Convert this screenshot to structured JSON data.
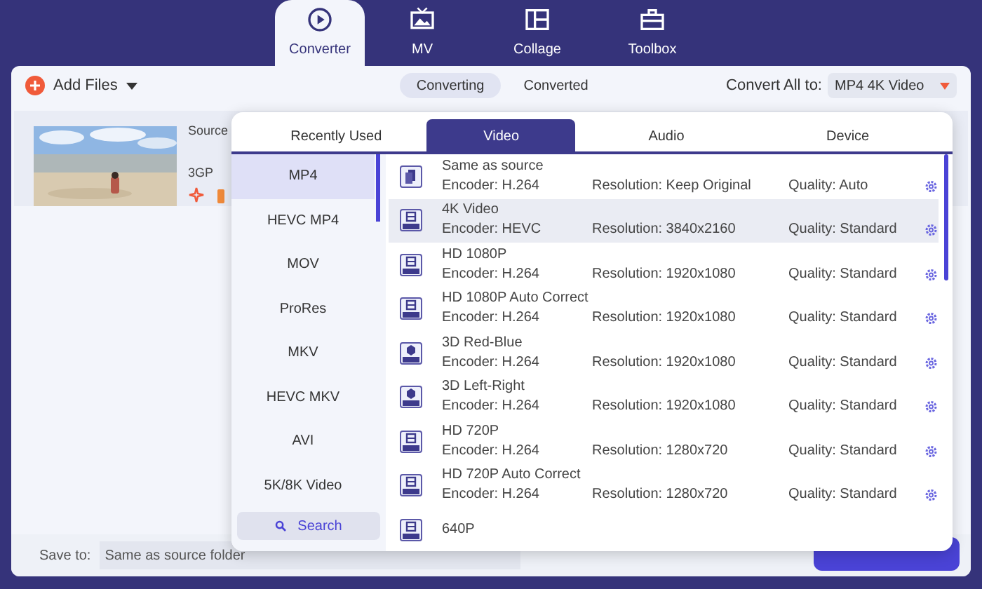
{
  "nav_tabs": [
    {
      "label": "Converter",
      "kind": "converter",
      "selected": true
    },
    {
      "label": "MV",
      "kind": "mv",
      "selected": false
    },
    {
      "label": "Collage",
      "kind": "collage",
      "selected": false
    },
    {
      "label": "Toolbox",
      "kind": "toolbox",
      "selected": false
    }
  ],
  "toolbar": {
    "add_files": "Add Files",
    "segments": [
      {
        "label": "Converting",
        "selected": true
      },
      {
        "label": "Converted",
        "selected": false
      }
    ],
    "convert_all_label": "Convert All to:",
    "convert_all_value": "MP4 4K Video"
  },
  "file": {
    "source_label": "Source",
    "format": "3GP"
  },
  "format_popup": {
    "tabs": [
      {
        "label": "Recently Used",
        "selected": false
      },
      {
        "label": "Video",
        "selected": true
      },
      {
        "label": "Audio",
        "selected": false
      },
      {
        "label": "Device",
        "selected": false
      }
    ],
    "categories": [
      {
        "label": "MP4",
        "selected": true
      },
      {
        "label": "HEVC MP4",
        "selected": false
      },
      {
        "label": "MOV",
        "selected": false
      },
      {
        "label": "ProRes",
        "selected": false
      },
      {
        "label": "MKV",
        "selected": false
      },
      {
        "label": "HEVC MKV",
        "selected": false
      },
      {
        "label": "AVI",
        "selected": false
      },
      {
        "label": "5K/8K Video",
        "selected": false
      }
    ],
    "search": "Search",
    "presets": [
      {
        "kind": "copy",
        "name": "Same as source",
        "encoder": "Encoder: H.264",
        "resolution": "Resolution: Keep Original",
        "quality": "Quality: Auto",
        "selected": false
      },
      {
        "kind": "film",
        "name": "4K Video",
        "encoder": "Encoder: HEVC",
        "resolution": "Resolution: 3840x2160",
        "quality": "Quality: Standard",
        "selected": true
      },
      {
        "kind": "film",
        "name": "HD 1080P",
        "encoder": "Encoder: H.264",
        "resolution": "Resolution: 1920x1080",
        "quality": "Quality: Standard",
        "selected": false
      },
      {
        "kind": "film",
        "name": "HD 1080P Auto Correct",
        "encoder": "Encoder: H.264",
        "resolution": "Resolution: 1920x1080",
        "quality": "Quality: Standard",
        "selected": false
      },
      {
        "kind": "cube",
        "name": "3D Red-Blue",
        "encoder": "Encoder: H.264",
        "resolution": "Resolution: 1920x1080",
        "quality": "Quality: Standard",
        "selected": false
      },
      {
        "kind": "cube",
        "name": "3D Left-Right",
        "encoder": "Encoder: H.264",
        "resolution": "Resolution: 1920x1080",
        "quality": "Quality: Standard",
        "selected": false
      },
      {
        "kind": "film",
        "name": "HD 720P",
        "encoder": "Encoder: H.264",
        "resolution": "Resolution: 1280x720",
        "quality": "Quality: Standard",
        "selected": false
      },
      {
        "kind": "film",
        "name": "HD 720P Auto Correct",
        "encoder": "Encoder: H.264",
        "resolution": "Resolution: 1280x720",
        "quality": "Quality: Standard",
        "selected": false
      },
      {
        "kind": "film",
        "name": "640P",
        "selected": false
      }
    ]
  },
  "bottom_bar": {
    "save_to_label": "Save to:",
    "save_to_value": "Same as source folder"
  }
}
